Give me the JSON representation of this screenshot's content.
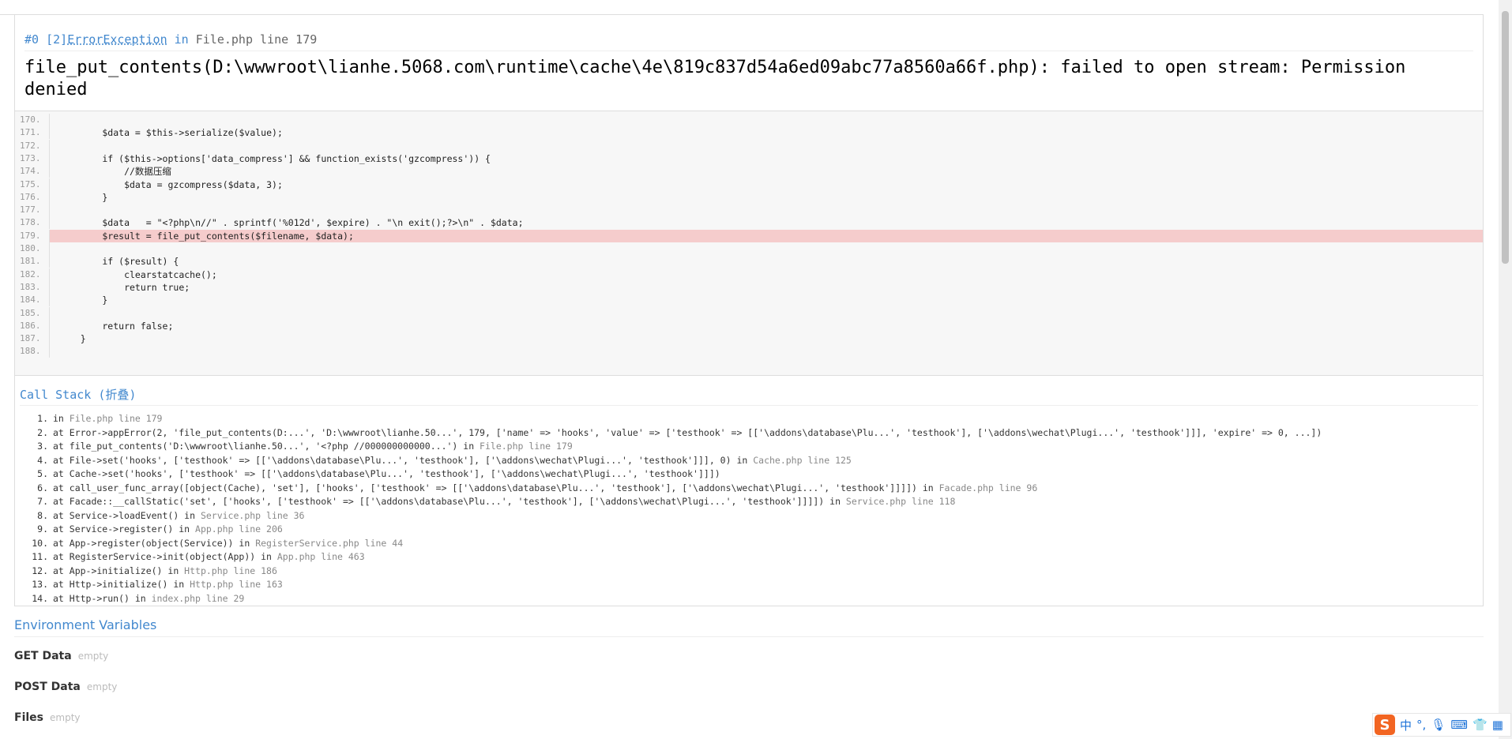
{
  "exception": {
    "index": "#0 [2]",
    "class": "ErrorException",
    "location": "File.php line 179",
    "message": "file_put_contents(D:\\wwwroot\\lianhe.5068.com\\runtime\\cache\\4e\\819c837d54a6ed09abc77a8560a66f.php): failed to open stream: Permission denied"
  },
  "source": {
    "highlight_line": 179,
    "lines": [
      {
        "num": "170.",
        "code": ""
      },
      {
        "num": "171.",
        "code": "        $data = $this->serialize($value);"
      },
      {
        "num": "172.",
        "code": ""
      },
      {
        "num": "173.",
        "code": "        if ($this->options['data_compress'] && function_exists('gzcompress')) {"
      },
      {
        "num": "174.",
        "code": "            //数据压缩"
      },
      {
        "num": "175.",
        "code": "            $data = gzcompress($data, 3);"
      },
      {
        "num": "176.",
        "code": "        }"
      },
      {
        "num": "177.",
        "code": ""
      },
      {
        "num": "178.",
        "code": "        $data   = \"<?php\\n//\" . sprintf('%012d', $expire) . \"\\n exit();?>\\n\" . $data;"
      },
      {
        "num": "179.",
        "code": "        $result = file_put_contents($filename, $data);"
      },
      {
        "num": "180.",
        "code": ""
      },
      {
        "num": "181.",
        "code": "        if ($result) {"
      },
      {
        "num": "182.",
        "code": "            clearstatcache();"
      },
      {
        "num": "183.",
        "code": "            return true;"
      },
      {
        "num": "184.",
        "code": "        }"
      },
      {
        "num": "185.",
        "code": ""
      },
      {
        "num": "186.",
        "code": "        return false;"
      },
      {
        "num": "187.",
        "code": "    }"
      },
      {
        "num": "188.",
        "code": ""
      }
    ]
  },
  "call_stack": {
    "title": "Call Stack (折叠)",
    "items": [
      {
        "n": "1.",
        "text": "in ",
        "where": "File.php line 179"
      },
      {
        "n": "2.",
        "text": "at Error->appError(2, 'file_put_contents(D:...', 'D:\\wwwroot\\lianhe.50...', 179, ['name' => 'hooks', 'value' => ['testhook' => [['\\addons\\database\\Plu...', 'testhook'], ['\\addons\\wechat\\Plugi...', 'testhook']]], 'expire' => 0, ...])",
        "where": ""
      },
      {
        "n": "3.",
        "text": "at file_put_contents('D:\\wwwroot\\lianhe.50...', '<?php //000000000000...') in ",
        "where": "File.php line 179"
      },
      {
        "n": "4.",
        "text": "at File->set('hooks', ['testhook' => [['\\addons\\database\\Plu...', 'testhook'], ['\\addons\\wechat\\Plugi...', 'testhook']]], 0) in ",
        "where": "Cache.php line 125"
      },
      {
        "n": "5.",
        "text": "at Cache->set('hooks', ['testhook' => [['\\addons\\database\\Plu...', 'testhook'], ['\\addons\\wechat\\Plugi...', 'testhook']]])",
        "where": ""
      },
      {
        "n": "6.",
        "text": "at call_user_func_array([object(Cache), 'set'], ['hooks', ['testhook' => [['\\addons\\database\\Plu...', 'testhook'], ['\\addons\\wechat\\Plugi...', 'testhook']]]]) in ",
        "where": "Facade.php line 96"
      },
      {
        "n": "7.",
        "text": "at Facade::__callStatic('set', ['hooks', ['testhook' => [['\\addons\\database\\Plu...', 'testhook'], ['\\addons\\wechat\\Plugi...', 'testhook']]]]) in ",
        "where": "Service.php line 118"
      },
      {
        "n": "8.",
        "text": "at Service->loadEvent() in ",
        "where": "Service.php line 36"
      },
      {
        "n": "9.",
        "text": "at Service->register() in ",
        "where": "App.php line 206"
      },
      {
        "n": "10.",
        "text": "at App->register(object(Service)) in ",
        "where": "RegisterService.php line 44"
      },
      {
        "n": "11.",
        "text": "at RegisterService->init(object(App)) in ",
        "where": "App.php line 463"
      },
      {
        "n": "12.",
        "text": "at App->initialize() in ",
        "where": "Http.php line 186"
      },
      {
        "n": "13.",
        "text": "at Http->initialize() in ",
        "where": "Http.php line 163"
      },
      {
        "n": "14.",
        "text": "at Http->run() in ",
        "where": "index.php line 29"
      }
    ]
  },
  "environment": {
    "title": "Environment Variables",
    "rows": [
      {
        "label": "GET Data",
        "value": "empty"
      },
      {
        "label": "POST Data",
        "value": "empty"
      },
      {
        "label": "Files",
        "value": "empty"
      }
    ]
  },
  "ime": {
    "logo": "S",
    "mode": "中",
    "punct": "°,"
  }
}
